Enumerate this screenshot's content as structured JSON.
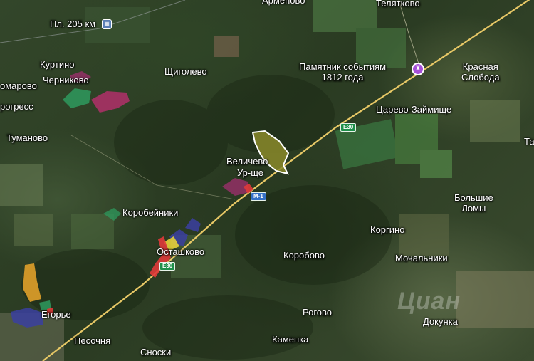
{
  "map": {
    "watermark": "Циан",
    "places": {
      "armenevo": "Армёново",
      "telyatkovo": "Телятково",
      "pl205": "Пл. 205 км",
      "kurtino": "Куртино",
      "chernikovo": "Черниково",
      "komarovo": "омарово",
      "progress": "рогресс",
      "tumanovo": "Туманово",
      "shchigolevo": "Щиголево",
      "monument": "Памятник событиям\n1812 года",
      "krasnaya_sloboda": "Красная\nСлобода",
      "tsarevo": "Царево-Займище",
      "velichevo": "Величево",
      "ur_shche": "Ур-ще",
      "korobeiniki": "Коробейники",
      "ostashkovo": "Осташково",
      "korobovo": "Коробово",
      "korgino": "Коргино",
      "bolshie_lomy": "Большие\nЛомы",
      "mochalniki": "Мочальники",
      "egorye": "Егорье",
      "rogovo": "Рогово",
      "dokunka": "Докунка",
      "pesochnya": "Песочня",
      "kamenka": "Каменка",
      "snoski": "Сноски",
      "edge_t": "Та"
    },
    "road_shields": {
      "e30_upper": "E30",
      "e30_lower": "E30",
      "m1": "М-1"
    },
    "icons": {
      "poi": "monument-pin-icon",
      "station": "rail-station-icon"
    },
    "colors": {
      "highway": "#e7c866",
      "parcel_olive": "#8a8a2a",
      "parcel_magenta": "#b0306a",
      "parcel_green": "#2e9a5e",
      "parcel_blue": "#3b3fa0",
      "parcel_orange": "#e0a02a",
      "parcel_red": "#e03a3a",
      "parcel_yellow": "#e6d23a",
      "poi": "#a650d8"
    }
  }
}
